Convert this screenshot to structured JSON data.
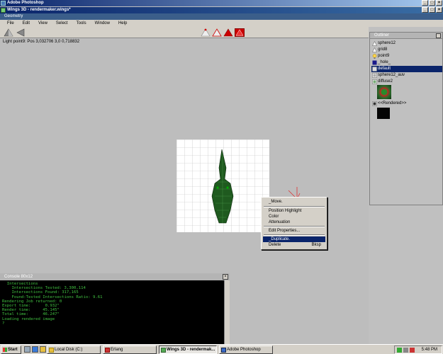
{
  "os": {
    "photoshop_title": "Adobe Photoshop",
    "taskbar": {
      "start_label": "Start",
      "tasks": [
        {
          "label": "Local Disk (C:)",
          "icon": "folder-icon"
        },
        {
          "label": "Erlang",
          "icon": "erlang-icon"
        },
        {
          "label": "Wings 3D - rendermak...",
          "icon": "wings-icon",
          "active": true
        },
        {
          "label": "Adobe Photoshop",
          "icon": "photoshop-icon"
        }
      ],
      "clock": "5:48 PM"
    }
  },
  "wings": {
    "title": "Wings 3D - rendermaker.wings*",
    "geometry_label": "Geometry",
    "menu": [
      "File",
      "Edit",
      "View",
      "Select",
      "Tools",
      "Window",
      "Help"
    ],
    "status": "Light point9: Pos 3,032706 3,0 0,718832",
    "context_menu": {
      "move": "_Move.",
      "position_highlight": "Position Highlight",
      "color": "Color",
      "attenuation": "Attenuation",
      "edit_properties": "Edit Properties...",
      "duplicate": "_Duplicate.",
      "delete": "Delete",
      "delete_shortcut": "Bksp"
    },
    "outliner": {
      "title": "Outliner",
      "items": [
        {
          "label": "sphere12",
          "icon": "object-icon"
        },
        {
          "label": "grid8",
          "icon": "object-icon"
        },
        {
          "label": "point9",
          "icon": "light-icon"
        },
        {
          "label": "_hole_",
          "icon": "material-icon"
        },
        {
          "label": "default",
          "icon": "material-icon",
          "selected": true
        },
        {
          "label": "sphere12_auv",
          "icon": "image-icon"
        },
        {
          "label": "diffuse2",
          "icon": "image-icon"
        },
        {
          "label": "<<Rendered>>",
          "icon": "image-icon"
        }
      ]
    },
    "console": {
      "title": "Console 80x12",
      "lines": [
        "  Intersections",
        "    Intersections Tested: 3,300,114",
        "    Intersections Found: 317,165",
        "    Found:Tested Intersections Ratio: 9.61",
        "",
        "Rendering Job returned: 0",
        "Export time:      0.932\"",
        "Render time:     45.145\"",
        "Total time:      46.247\"",
        "Loading rendered image",
        "",
        "?"
      ]
    },
    "colors": {
      "accent": "#0a246a",
      "console_text": "#40c040",
      "object_green": "#1f5a1f"
    }
  }
}
